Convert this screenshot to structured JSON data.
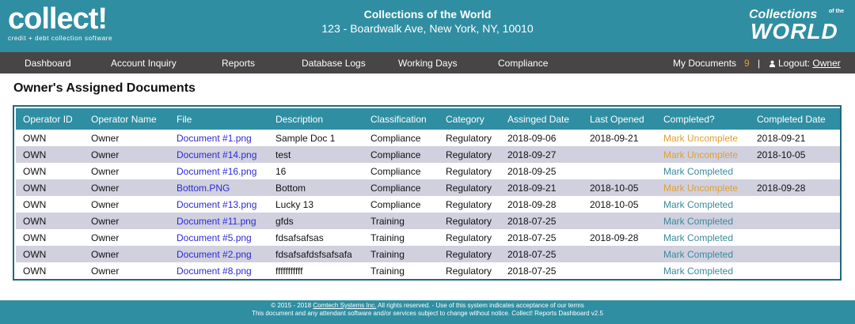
{
  "header": {
    "logo_main": "collect!",
    "logo_sub": "credit + debt collection software",
    "company_name": "Collections of the World",
    "company_address": "123 - Boardwalk Ave, New York, NY, 10010",
    "brand_top": "Collections",
    "brand_of": "of the",
    "brand_bottom": "WORLD"
  },
  "nav": {
    "items": [
      "Dashboard",
      "Account Inquiry",
      "Reports",
      "Database Logs",
      "Working Days",
      "Compliance"
    ],
    "my_documents_label": "My Documents",
    "my_documents_count": "9",
    "separator": "|",
    "logout_label": "Logout:",
    "logout_user": "Owner",
    "user_icon": "user-icon"
  },
  "page_title": "Owner's Assigned Documents",
  "table": {
    "headers": [
      "Operator ID",
      "Operator Name",
      "File",
      "Description",
      "Classification",
      "Category",
      "Assinged Date",
      "Last Opened",
      "Completed?",
      "Completed Date"
    ],
    "rows": [
      {
        "operator_id": "OWN",
        "operator_name": "Owner",
        "file": "Document #1.png",
        "description": "Sample Doc 1",
        "classification": "Compliance",
        "category": "Regulatory",
        "assigned_date": "2018-09-06",
        "last_opened": "2018-09-21",
        "completed": "Mark Uncomplete",
        "completed_date": "2018-09-21"
      },
      {
        "operator_id": "OWN",
        "operator_name": "Owner",
        "file": "Document #14.png",
        "description": "test",
        "classification": "Compliance",
        "category": "Regulatory",
        "assigned_date": "2018-09-27",
        "last_opened": "",
        "completed": "Mark Uncomplete",
        "completed_date": "2018-10-05"
      },
      {
        "operator_id": "OWN",
        "operator_name": "Owner",
        "file": "Document #16.png",
        "description": "16",
        "classification": "Compliance",
        "category": "Regulatory",
        "assigned_date": "2018-09-25",
        "last_opened": "",
        "completed": "Mark Completed",
        "completed_date": ""
      },
      {
        "operator_id": "OWN",
        "operator_name": "Owner",
        "file": "Bottom.PNG",
        "description": "Bottom",
        "classification": "Compliance",
        "category": "Regulatory",
        "assigned_date": "2018-09-21",
        "last_opened": "2018-10-05",
        "completed": "Mark Uncomplete",
        "completed_date": "2018-09-28"
      },
      {
        "operator_id": "OWN",
        "operator_name": "Owner",
        "file": "Document #13.png",
        "description": "Lucky 13",
        "classification": "Compliance",
        "category": "Regulatory",
        "assigned_date": "2018-09-28",
        "last_opened": "2018-10-05",
        "completed": "Mark Completed",
        "completed_date": ""
      },
      {
        "operator_id": "OWN",
        "operator_name": "Owner",
        "file": "Document #11.png",
        "description": "gfds",
        "classification": "Training",
        "category": "Regulatory",
        "assigned_date": "2018-07-25",
        "last_opened": "",
        "completed": "Mark Completed",
        "completed_date": ""
      },
      {
        "operator_id": "OWN",
        "operator_name": "Owner",
        "file": "Document #5.png",
        "description": "fdsafsafsas",
        "classification": "Training",
        "category": "Regulatory",
        "assigned_date": "2018-07-25",
        "last_opened": "2018-09-28",
        "completed": "Mark Completed",
        "completed_date": ""
      },
      {
        "operator_id": "OWN",
        "operator_name": "Owner",
        "file": "Document #2.png",
        "description": "fdsafsafdsfsafsafa",
        "classification": "Training",
        "category": "Regulatory",
        "assigned_date": "2018-07-25",
        "last_opened": "",
        "completed": "Mark Completed",
        "completed_date": ""
      },
      {
        "operator_id": "OWN",
        "operator_name": "Owner",
        "file": "Document #8.png",
        "description": "fffffffffff",
        "classification": "Training",
        "category": "Regulatory",
        "assigned_date": "2018-07-25",
        "last_opened": "",
        "completed": "Mark Completed",
        "completed_date": ""
      }
    ]
  },
  "footer": {
    "line1_prefix": "© 2015 - 2018",
    "line1_link": "Comtech Systems Inc.",
    "line1_suffix": "All rights reserved. - Use of this system indicates acceptance of our terms",
    "line2": "This document and any attendant software and/or services subject to change without notice. Collect! Reports Dashboard v2.5"
  },
  "colors": {
    "header_bg": "#2f8ea2",
    "nav_bg": "#474545",
    "table_border": "#1f6a7b",
    "row_alt": "#d0d0df",
    "link": "#2b2bd6",
    "uncomplete": "#e0a030",
    "completed": "#3a8a9a"
  }
}
